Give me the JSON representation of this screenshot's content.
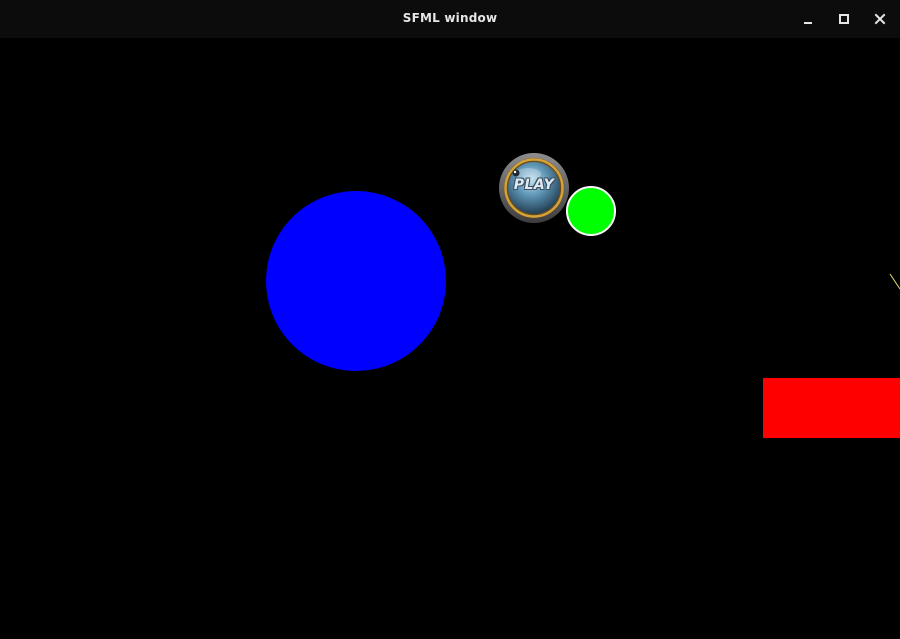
{
  "window": {
    "title": "SFML window",
    "controls": {
      "minimize_icon": "minimize-icon",
      "maximize_icon": "maximize-icon",
      "close_icon": "close-icon"
    }
  },
  "scene": {
    "background_color": "#000000",
    "play_button": {
      "label": "PLAY"
    },
    "shapes": [
      {
        "type": "circle",
        "color": "#0000ff"
      },
      {
        "type": "circle",
        "color": "#00ff00",
        "outline": "#ffffff"
      },
      {
        "type": "rectangle",
        "color": "#ff0000"
      },
      {
        "type": "line",
        "color": "#e8e070"
      }
    ]
  }
}
